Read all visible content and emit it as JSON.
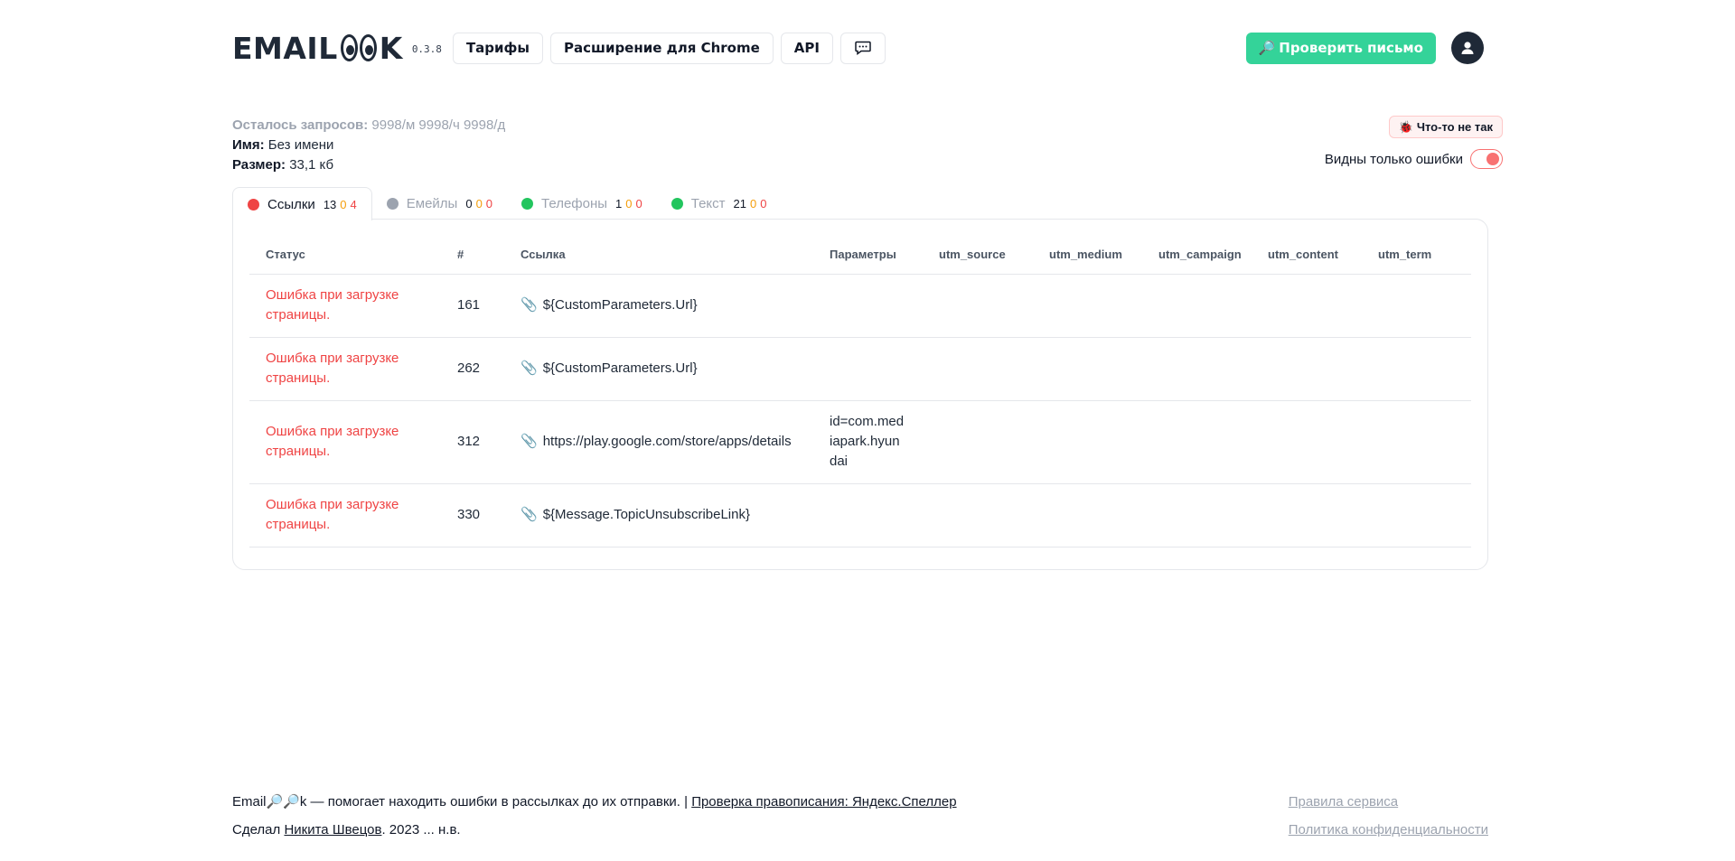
{
  "header": {
    "logo_left": "EMAIL",
    "logo_right": "K",
    "version": "0.3.8",
    "nav": [
      "Тарифы",
      "Расширение для Chrome",
      "API"
    ],
    "check_button": "Проверить письмо"
  },
  "info": {
    "requests_label": "Осталось запросов:",
    "requests_value": "9998/м 9998/ч 9998/д",
    "name_label": "Имя:",
    "name_value": "Без имени",
    "size_label": "Размер:",
    "size_value": "33,1 кб"
  },
  "controls": {
    "bug_button": "Что-то не так",
    "toggle_label": "Видны только ошибки",
    "toggle_on": true
  },
  "tabs": [
    {
      "label": "Ссылки",
      "c1": "13",
      "c2": "0",
      "c3": "4",
      "dot": "#ef4444",
      "active": true
    },
    {
      "label": "Емейлы",
      "c1": "0",
      "c2": "0",
      "c3": "0",
      "dot": "#9ca3af",
      "active": false
    },
    {
      "label": "Телефоны",
      "c1": "1",
      "c2": "0",
      "c3": "0",
      "dot": "#22c55e",
      "active": false
    },
    {
      "label": "Текст",
      "c1": "21",
      "c2": "0",
      "c3": "0",
      "dot": "#22c55e",
      "active": false
    }
  ],
  "table": {
    "columns": [
      "Статус",
      "#",
      "Ссылка",
      "Параметры",
      "utm_source",
      "utm_medium",
      "utm_campaign",
      "utm_content",
      "utm_term"
    ],
    "rows": [
      {
        "status": "Ошибка при загрузке страницы.",
        "num": "161",
        "link": "${CustomParameters.Url}",
        "params": ""
      },
      {
        "status": "Ошибка при загрузке страницы.",
        "num": "262",
        "link": "${CustomParameters.Url}",
        "params": ""
      },
      {
        "status": "Ошибка при загрузке страницы.",
        "num": "312",
        "link": "https://play.google.com/store/apps/details",
        "params": "id=com.mediapark.hyundai"
      },
      {
        "status": "Ошибка при загрузке страницы.",
        "num": "330",
        "link": "${Message.TopicUnsubscribeLink}",
        "params": ""
      }
    ]
  },
  "footer": {
    "tagline_start": "Email",
    "tagline_end": "k — помогает находить ошибки в рассылках до их отправки. |",
    "speller_link": "Проверка правописания: Яндекс.Спеллер",
    "made_by": "Сделал",
    "author_link": "Никита Швецов",
    "years": ". 2023 ... н.в.",
    "rules_link": "Правила сервиса",
    "privacy_link": "Политика конфиденциальности"
  },
  "colors": {
    "accent": "#34d399",
    "error": "#ef4444",
    "warning": "#f59e0b"
  }
}
